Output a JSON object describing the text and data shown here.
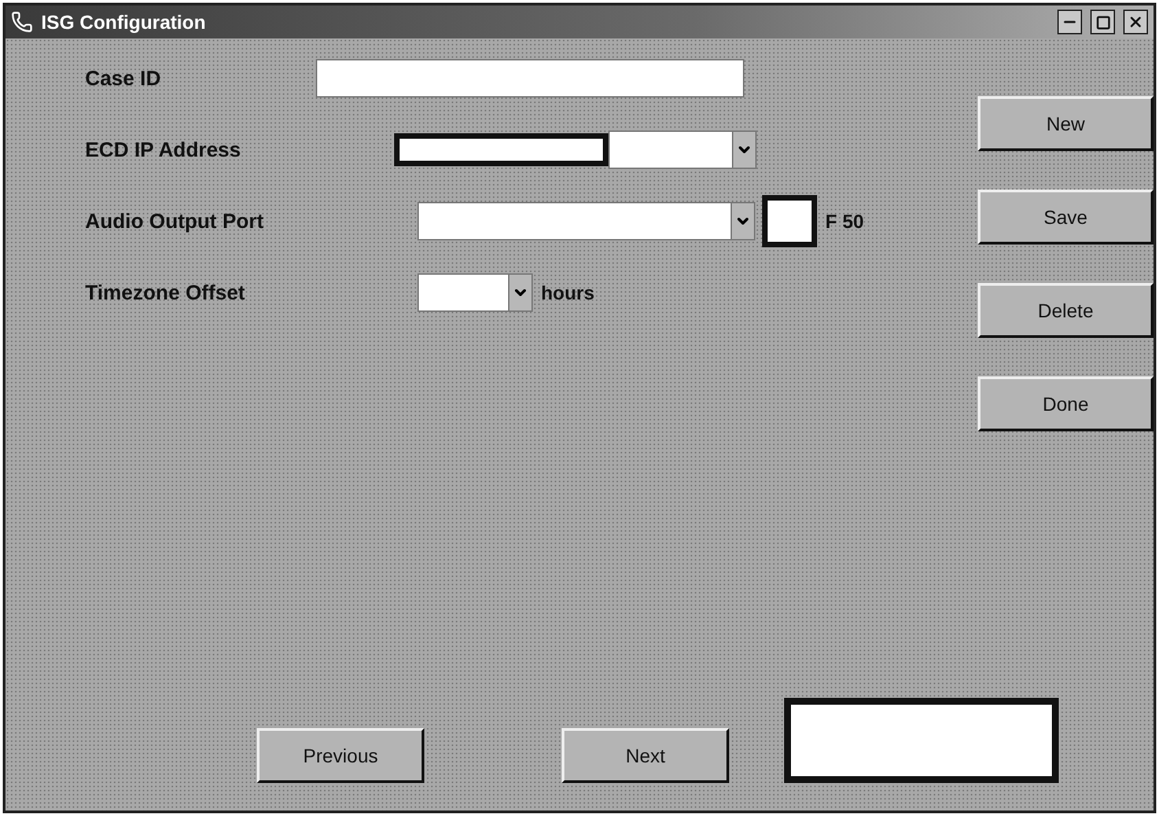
{
  "window": {
    "title": "ISG Configuration"
  },
  "fields": [
    {
      "kind": "text",
      "label": "Case ID"
    },
    {
      "kind": "ip",
      "label": "ECD IP Address"
    },
    {
      "kind": "combo",
      "label": "Audio Output Port",
      "suffix": "F 50"
    },
    {
      "kind": "small-combo",
      "label": "Timezone Offset",
      "suffix": "hours"
    }
  ],
  "side_buttons": [
    "New",
    "Save",
    "Delete",
    "Done"
  ],
  "nav_buttons": [
    "Previous",
    "Next"
  ]
}
